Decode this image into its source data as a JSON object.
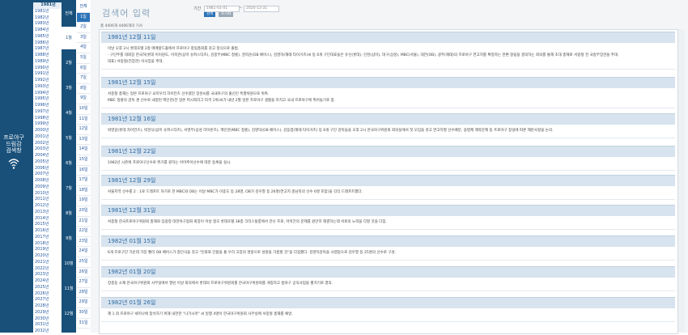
{
  "sidebar": {
    "brand_lines": [
      "프로야구",
      "드림감",
      "검색창"
    ],
    "brand_icon": "wifi-icon"
  },
  "years": {
    "items": [
      "1981년",
      "1981년",
      "1982년",
      "1983년",
      "1984년",
      "1985년",
      "1986년",
      "1987년",
      "1988년",
      "1989년",
      "1990년",
      "1991년",
      "1992년",
      "1993년",
      "1994년",
      "1995년",
      "1996년",
      "1997년",
      "1998년",
      "1999년",
      "2000년",
      "2001년",
      "2002년",
      "2003년",
      "2004년",
      "2005년",
      "2006년",
      "2007년",
      "2008년",
      "2009년",
      "2010년",
      "2011년",
      "2012년",
      "2013년",
      "2014년",
      "2015년",
      "2016년",
      "2017년",
      "2018년",
      "2019년",
      "2020년",
      "2021년",
      "2022년",
      "2023년",
      "2024년",
      "2025년",
      "2026년",
      "2027년",
      "2028년",
      "2029년",
      "2030년",
      "2031년",
      "2032년"
    ]
  },
  "months": {
    "items": [
      "전체",
      "1월",
      "2월",
      "3월",
      "4월",
      "5월",
      "6월",
      "7월",
      "8월",
      "9월",
      "10월",
      "11월",
      "12월"
    ]
  },
  "days": {
    "items": [
      "전체",
      "1일",
      "2일",
      "3일",
      "4일",
      "5일",
      "6일",
      "7일",
      "8일",
      "9일",
      "10일",
      "11일",
      "12일",
      "13일",
      "14일",
      "15일",
      "16일",
      "17일",
      "18일",
      "19일",
      "20일",
      "21일",
      "22일",
      "23일",
      "24일",
      "25일",
      "26일",
      "27일",
      "28일",
      "29일",
      "30일",
      "31일"
    ]
  },
  "header": {
    "title": "검색어 입력",
    "period_label": "기간",
    "start_date": "1981-01-01",
    "end_date": "2020-12-31",
    "search_label": "검색",
    "reset_label": "초기화",
    "count_text": "총 4406개 4406개의 기사"
  },
  "colors": {
    "brand": "#18507a",
    "accent": "#2b6aa6",
    "header_band": "#d7e3ee",
    "search_btn": "#2b73b8",
    "reset_btn": "#9aa8b5"
  },
  "entries": [
    {
      "date": "1981년 12월 11일",
      "lines": [
        "이날 오후 2시 롯데호텔 2층 에메랄드홀에서 프로야구 창립총회를 갖고 정식으로 출범.",
        "· 구단주를 대회장 한국허(롯데 이이원도, 이북관(삼미 슈퍼스타즈), 김봉무(MBC 청룡), 권하운(OB 베어스), 김영하(해태 타이거즈)씨 등 6개 구단대표들은 유신(롯데), 인천(삼미), 대구(삼성), MBC(서울), 대전(OB), 광주(해태)의 프로야구 연고지를 확정하는 한편 창립을 결의하는 회의를 통해 초대 총재로 서종철 전 국방부장관을 추대.",
        "대표) 서종철(전장관) 이사장을 추대."
      ]
    },
    {
      "date": "1981년 12월 15일",
      "lines": [
        "서종철 총재는 일본 프로야구 요미우리 자이언츠 선수였던 장훈씨를 국내야구의 출신인 특별위원으로 위촉.",
        "MBC 청룡의 감독 겸 선수로 내정된 백인천(전 일본 퍼시픽리그 타격 1위)씨가 내년 2월 일본 프로야구 생활을 마치고 국내 프로야구에 뛰어들기로 함."
      ]
    },
    {
      "date": "1981년 12월 16일",
      "lines": [
        "박영길(롯데 자이언츠), 박현식(삼미 슈퍼스타즈), 서영무(삼성 라이온즈), 백인천(MBC 청룡), 김영덕(OB 베어스), 김동엽(해태 타이거즈) 등 6개 구단 감독들을 오후 2시 한국야구위원회 회의실에서 첫 모임을 갖고 연고지별 선수배분, 용병제 계약문제 등 프로야구 창설에 따른 제반사항을 논의."
      ]
    },
    {
      "date": "1981년 12월 22일",
      "lines": [
        "1982년 시즌에 프로야구선수로 뛰기를 원하는 아마추어선수에 대한 등록을 실시."
      ]
    },
    {
      "date": "1981년 12월 29일",
      "lines": [
        "서울지역 선수를 2 : 1로 드래프트 하기로 한 MBC와 OB는 이날 MBC가 이종도 등 28명, OB가 김우열 등 26명(연고지 충남북의 선수 6명 포함)을 각각 드래프트했다."
      ]
    },
    {
      "date": "1981년 12월 31일",
      "lines": [
        "서종철 한국프로야구위원회 총재와 임광정 대한야구협회 회장이 이날 정오 롯데호텔 38층 크리스탈룸에서 만나 프로, 아마간의 문제를 원만히 해결하는데 서로의 노력을 다할 것을 다짐."
      ]
    },
    {
      "date": "1982년 01월 15일",
      "lines": [
        "6개 프로구단 가운데 가장 빨리 OB 베어스가 창단식을 갖고 \"인화와 단합을 통 우리 고장의 명랑으로 성원을 가름할 것\"을 다짐했다. 김영덕감독을 사령탑으로 김우열 등 25명의 선수로 구성."
      ]
    },
    {
      "date": "1982년 01월 20일",
      "lines": [
        "장충동 소재 한국야구위원회 사무실에서 열린 이날 회의에서 롯데의 프로야구위원회를 한국야구위원회를 개칭하고 범야구 공익사업을 펼치기로 결의."
      ]
    },
    {
      "date": "1982년 01월 26일",
      "lines": [
        "제 1 회 프로야구 세미나에 참석하기 위해 내한한 \"나가시마\" 씨 일행 4명이 한국야구위원회 사무실에 서종철 총재를 예방."
      ]
    }
  ]
}
